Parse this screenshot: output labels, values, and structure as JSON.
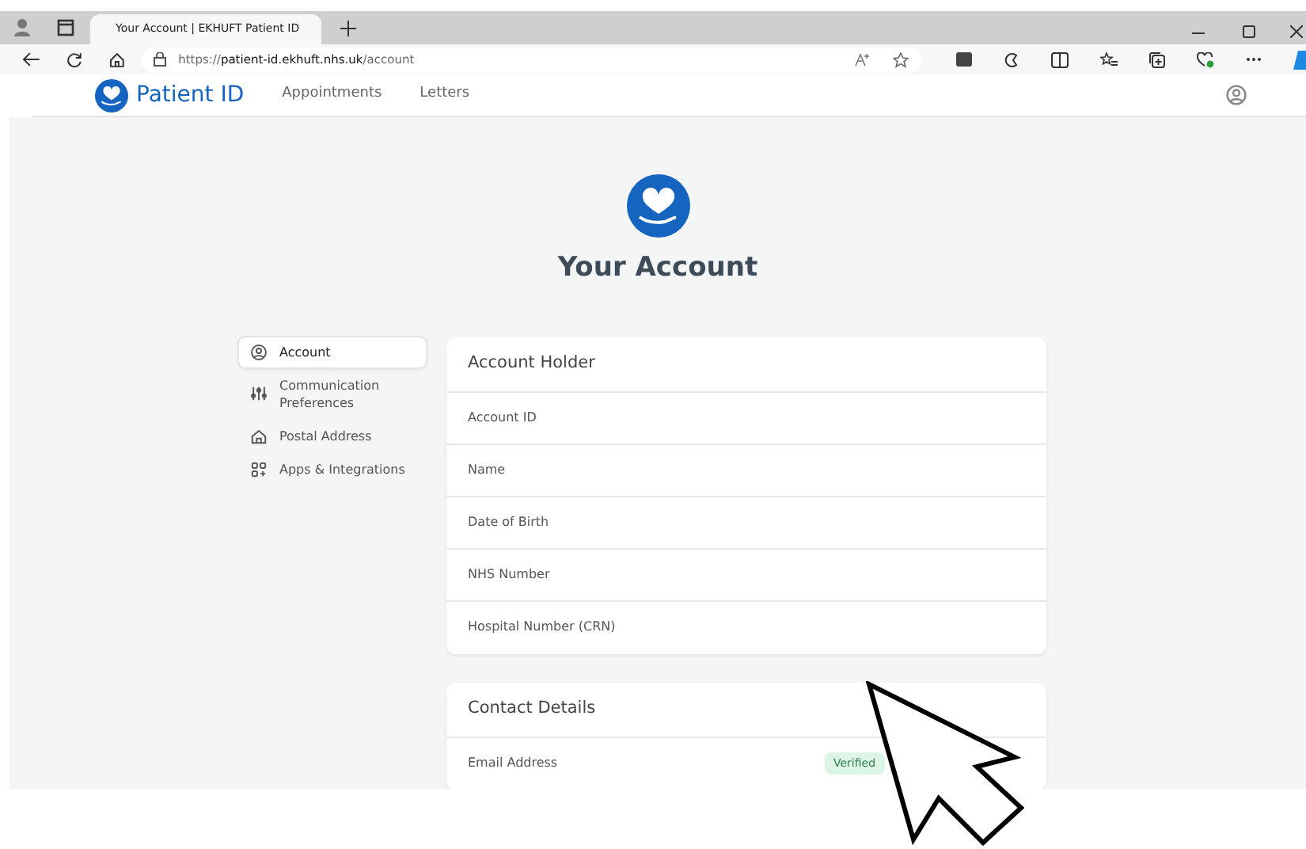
{
  "browser": {
    "tab_title": "Your Account | EKHUFT Patient ID",
    "url_prefix": "https://",
    "url_host": "patient-id.ekhuft.nhs.uk",
    "url_path": "/account"
  },
  "app_nav": {
    "brand": "Patient ID",
    "links": [
      {
        "label": "Appointments"
      },
      {
        "label": "Letters"
      }
    ]
  },
  "page": {
    "title": "Your Account"
  },
  "sidebar": {
    "items": [
      {
        "label": "Account",
        "selected": true
      },
      {
        "label": "Communication Preferences",
        "selected": false
      },
      {
        "label": "Postal Address",
        "selected": false
      },
      {
        "label": "Apps & Integrations",
        "selected": false
      }
    ]
  },
  "cards": [
    {
      "title": "Account Holder",
      "rows": [
        {
          "label": "Account ID"
        },
        {
          "label": "Name"
        },
        {
          "label": "Date of Birth"
        },
        {
          "label": "NHS Number"
        },
        {
          "label": "Hospital Number (CRN)"
        }
      ]
    },
    {
      "title": "Contact Details",
      "rows": [
        {
          "label": "Email Address",
          "badge": "Verified"
        }
      ]
    }
  ]
}
